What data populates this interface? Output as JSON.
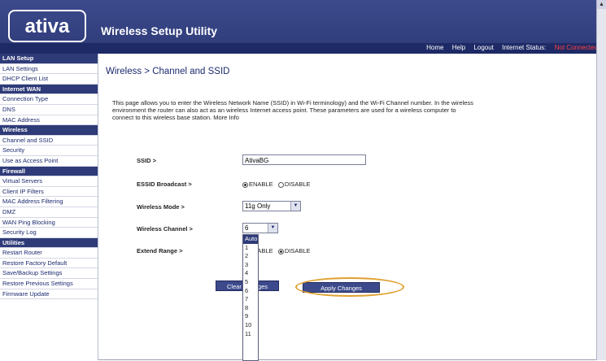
{
  "header": {
    "logo": "ativa",
    "title": "Wireless Setup Utility",
    "links": [
      "Home",
      "Help",
      "Logout"
    ],
    "status_label": "Internet Status:",
    "status_value": "Not Connected"
  },
  "sidebar": {
    "rows": [
      {
        "label": "LAN Setup",
        "type": "section"
      },
      {
        "label": "LAN Settings",
        "type": "item"
      },
      {
        "label": "DHCP Client List",
        "type": "item"
      },
      {
        "label": "Internet WAN",
        "type": "section"
      },
      {
        "label": "Connection Type",
        "type": "item"
      },
      {
        "label": "DNS",
        "type": "item"
      },
      {
        "label": "MAC Address",
        "type": "item"
      },
      {
        "label": "Wireless",
        "type": "section"
      },
      {
        "label": "Channel and SSID",
        "type": "item"
      },
      {
        "label": "Security",
        "type": "item"
      },
      {
        "label": "Use as Access Point",
        "type": "item"
      },
      {
        "label": "Firewall",
        "type": "section"
      },
      {
        "label": "Virtual Servers",
        "type": "item"
      },
      {
        "label": "Client IP Filters",
        "type": "item"
      },
      {
        "label": "MAC Address Filtering",
        "type": "item"
      },
      {
        "label": "DMZ",
        "type": "item"
      },
      {
        "label": "WAN Ping Blocking",
        "type": "item"
      },
      {
        "label": "Security Log",
        "type": "item"
      },
      {
        "label": "Utilities",
        "type": "section"
      },
      {
        "label": "Restart Router",
        "type": "item"
      },
      {
        "label": "Restore Factory Default",
        "type": "item"
      },
      {
        "label": "Save/Backup Settings",
        "type": "item"
      },
      {
        "label": "Restore Previous Settings",
        "type": "item"
      },
      {
        "label": "Firmware Update",
        "type": "item"
      }
    ]
  },
  "main": {
    "title": "Wireless > Channel and SSID",
    "description": "This page allows you to enter the Wireless Network Name (SSID) in Wi-Fi terminology) and the Wi-Fi Channel number. In the wireless environment the router can also act as an wireless Internet access point. These parameters are used for a wireless computer to connect to this wireless base station. More Info",
    "fields": {
      "ssid_label": "SSID >",
      "ssid_value": "AtivaBG",
      "broadcast_label": "ESSID Broadcast >",
      "broadcast_enable": "ENABLE",
      "broadcast_disable": "DISABLE",
      "mode_label": "Wireless Mode >",
      "mode_value": "11g Only",
      "channel_label": "Wireless Channel >",
      "channel_value": "6",
      "range_label": "Extend Range >",
      "range_enable": "ENABLE",
      "range_disable": "DISABLE"
    },
    "channel_options": [
      "Auto",
      "1",
      "2",
      "3",
      "4",
      "5",
      "6",
      "7",
      "8",
      "9",
      "10",
      "11"
    ],
    "buttons": {
      "clear": "Clear Changes",
      "apply": "Apply Changes"
    }
  },
  "colors": {
    "header_bg": "#2f3b78",
    "highlight_ring": "#e0a030"
  }
}
